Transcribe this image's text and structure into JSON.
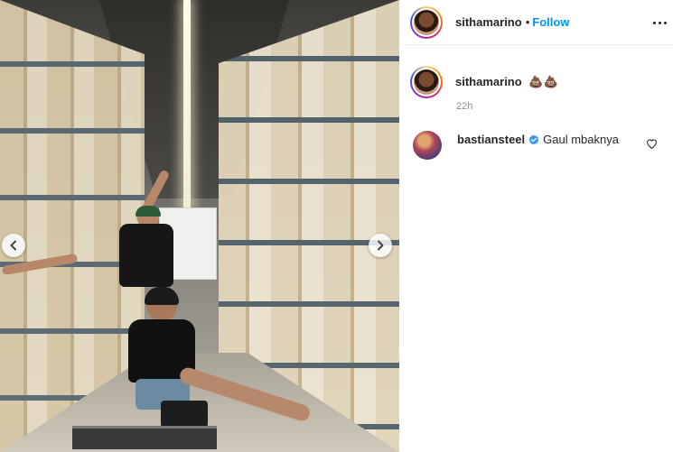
{
  "post": {
    "author": "sithamarino",
    "follow_label": "Follow",
    "separator": "•"
  },
  "caption": {
    "username": "sithamarino",
    "text": "💩💩",
    "time": "22h"
  },
  "comments": [
    {
      "username": "bastiansteel",
      "verified": true,
      "text": "Gaul mbaknya"
    }
  ],
  "icons": {
    "prev": "chevron-left-icon",
    "next": "chevron-right-icon",
    "more": "more-options-icon",
    "like": "heart-icon",
    "verified": "verified-badge-icon"
  },
  "colors": {
    "follow": "#0095f6",
    "verified": "#3897f0",
    "muted": "#8e8e8e"
  }
}
